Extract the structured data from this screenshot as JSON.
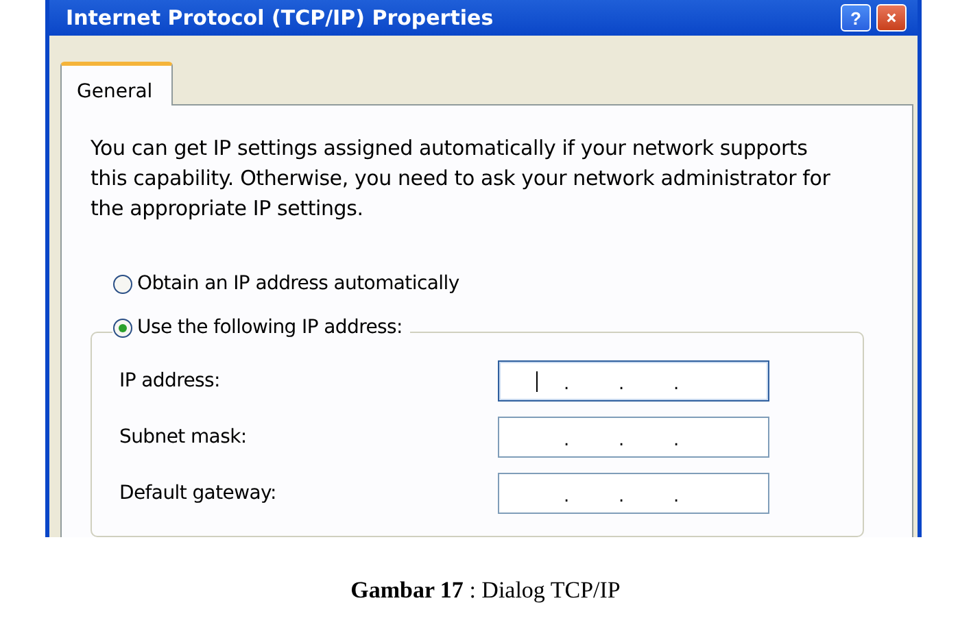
{
  "window": {
    "title": "Internet Protocol (TCP/IP) Properties",
    "title_buttons": [
      {
        "kind": "help",
        "label": "?"
      },
      {
        "kind": "close"
      }
    ]
  },
  "tabs": [
    {
      "label": "General",
      "selected": true
    }
  ],
  "description": "You can get IP settings assigned automatically if your network supports this capability. Otherwise, you need to ask your network administrator for the appropriate IP settings.",
  "options": [
    {
      "label": "Obtain an IP address automatically",
      "selected": false
    },
    {
      "label": "Use the following IP address:",
      "selected": true
    }
  ],
  "fields": [
    {
      "label": "IP address:",
      "separators": [
        ".",
        ".",
        "."
      ],
      "focused": true
    },
    {
      "label": "Subnet mask:",
      "separators": [
        ".",
        ".",
        "."
      ],
      "focused": false
    },
    {
      "label": "Default gateway:",
      "separators": [
        ".",
        ".",
        "."
      ],
      "focused": false
    }
  ],
  "caption": "**Gambar 17** : Dialog TCP/IP"
}
